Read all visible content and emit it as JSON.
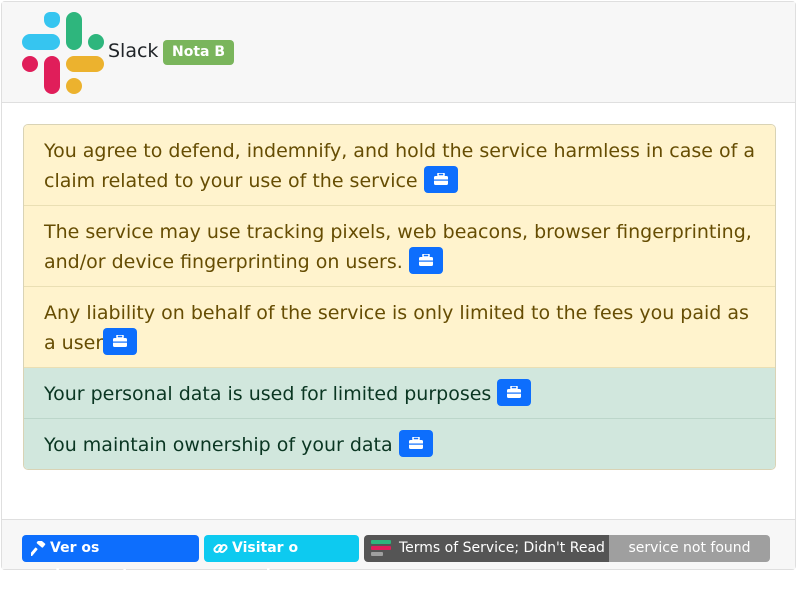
{
  "header": {
    "service_name": "Slack",
    "grade_badge": "Nota B",
    "grade_color": "#7ab55c"
  },
  "points": [
    {
      "text": "You agree to defend, indemnify, and hold the service harmless in case of a claim related to your use of the service",
      "kind": "warning",
      "icon": "briefcase-icon"
    },
    {
      "text": "The service may use tracking pixels, web beacons, browser fingerprinting, and/or device fingerprinting on users.",
      "kind": "warning",
      "icon": "briefcase-icon"
    },
    {
      "text": "Any liability on behalf of the service is only limited to the fees you paid as a user",
      "kind": "warning",
      "icon": "briefcase-icon"
    },
    {
      "text": "Your personal data is used for limited purposes",
      "kind": "good",
      "icon": "briefcase-icon"
    },
    {
      "text": "You maintain ownership of your data",
      "kind": "good",
      "icon": "briefcase-icon"
    }
  ],
  "footer": {
    "documents_button": "Ver os documentos",
    "documents_icon": "hammer-icon",
    "visit_button": "Visitar o serviço",
    "visit_icon": "link-icon",
    "tosdr_label": "Terms of Service; Didn't Read",
    "tosdr_status": "service not found"
  },
  "colors": {
    "primary": "#0d6efd",
    "info": "#0dcaf0",
    "warning_bg": "#fff3cd",
    "good_bg": "#d1e7dd"
  }
}
